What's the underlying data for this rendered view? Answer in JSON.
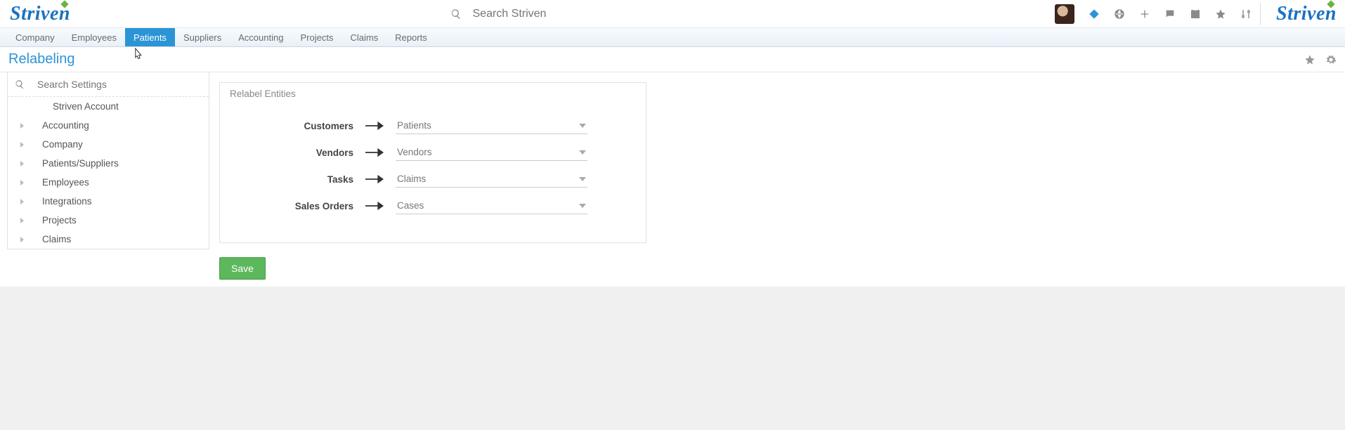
{
  "header": {
    "brand": "Striven",
    "search_placeholder": "Search Striven"
  },
  "nav_tabs": [
    {
      "label": "Company",
      "active": false
    },
    {
      "label": "Employees",
      "active": false
    },
    {
      "label": "Patients",
      "active": true
    },
    {
      "label": "Suppliers",
      "active": false
    },
    {
      "label": "Accounting",
      "active": false
    },
    {
      "label": "Projects",
      "active": false
    },
    {
      "label": "Claims",
      "active": false
    },
    {
      "label": "Reports",
      "active": false
    }
  ],
  "page": {
    "title": "Relabeling"
  },
  "sidebar": {
    "search_placeholder": "Search Settings",
    "items": [
      {
        "label": "Striven Account",
        "leaf": true
      },
      {
        "label": "Accounting",
        "leaf": false
      },
      {
        "label": "Company",
        "leaf": false
      },
      {
        "label": "Patients/Suppliers",
        "leaf": false
      },
      {
        "label": "Employees",
        "leaf": false
      },
      {
        "label": "Integrations",
        "leaf": false
      },
      {
        "label": "Projects",
        "leaf": false
      },
      {
        "label": "Claims",
        "leaf": false
      }
    ]
  },
  "panel": {
    "title": "Relabel Entities",
    "rows": [
      {
        "label": "Customers",
        "value": "Patients"
      },
      {
        "label": "Vendors",
        "value": "Vendors"
      },
      {
        "label": "Tasks",
        "value": "Claims"
      },
      {
        "label": "Sales Orders",
        "value": "Cases"
      }
    ]
  },
  "buttons": {
    "save": "Save"
  }
}
